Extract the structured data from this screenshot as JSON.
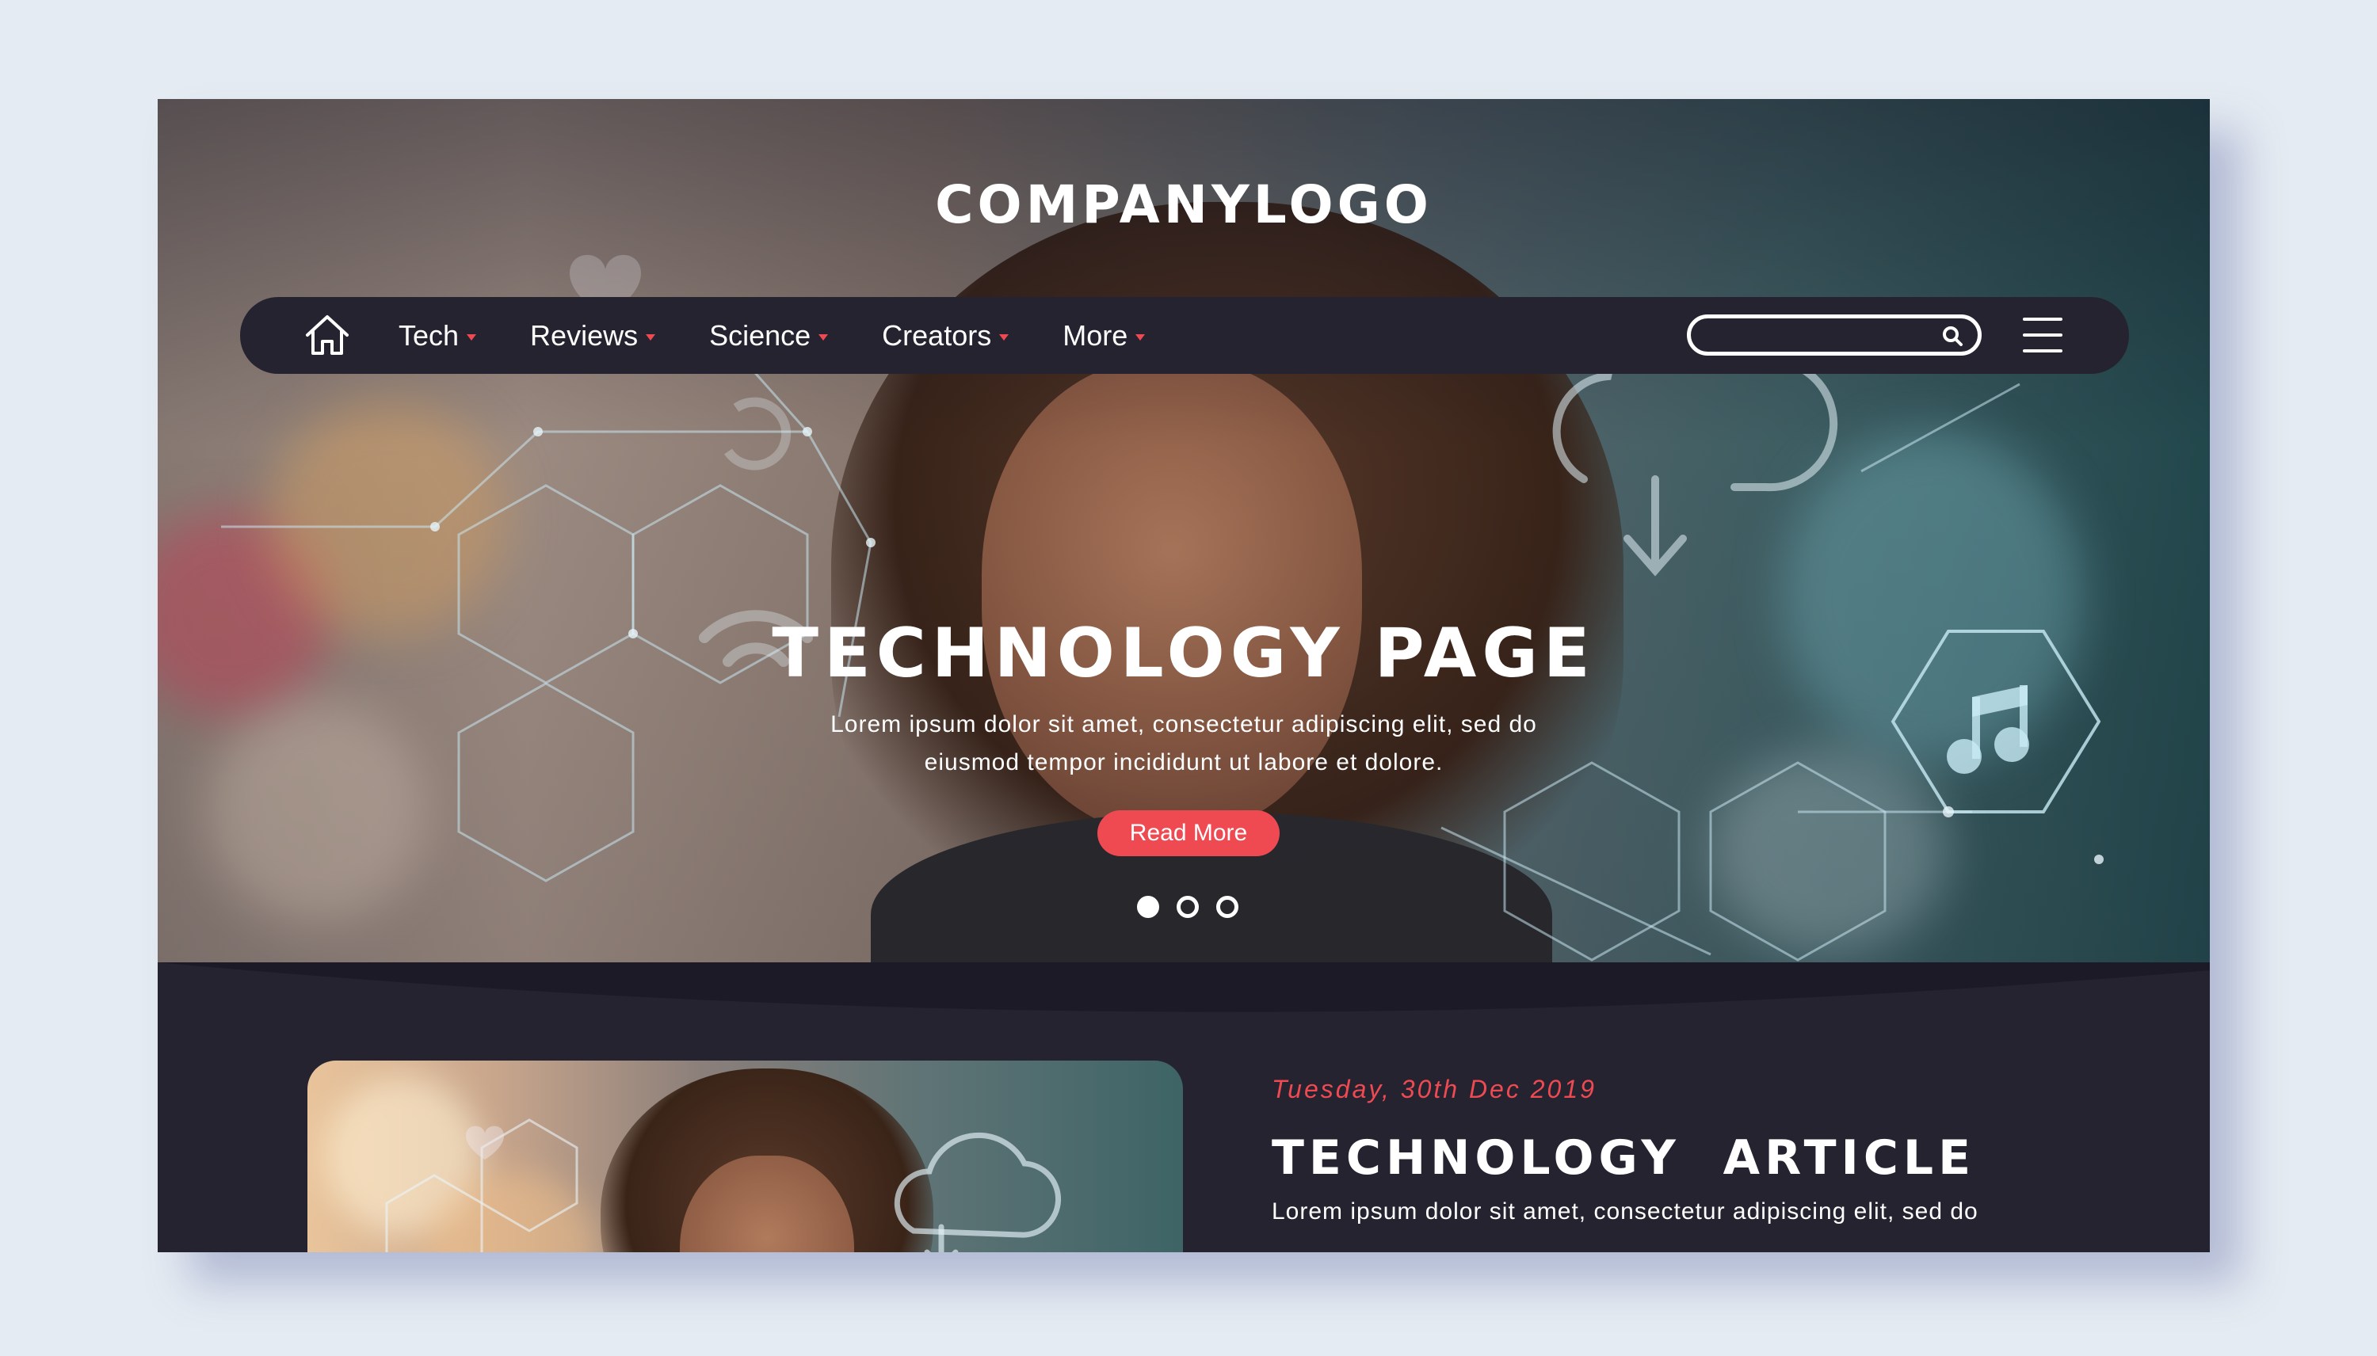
{
  "header": {
    "logo": "COMPANYLOGO"
  },
  "nav": {
    "home_icon": "home-icon",
    "items": [
      {
        "label": "Tech"
      },
      {
        "label": "Reviews"
      },
      {
        "label": "Science"
      },
      {
        "label": "Creators"
      },
      {
        "label": "More"
      }
    ],
    "search": {
      "value": "",
      "placeholder": "",
      "icon": "search-icon"
    },
    "menu_icon": "hamburger-icon"
  },
  "hero": {
    "title": "TECHNOLOGY PAGE",
    "description": "Lorem ipsum dolor sit amet, consectetur adipiscing elit, sed do eiusmod tempor incididunt ut labore et dolore.",
    "cta_label": "Read More",
    "slides": {
      "total": 3,
      "active": 1
    }
  },
  "article": {
    "date": "Tuesday, 30th Dec 2019",
    "title": "TECHNOLOGY  ARTICLE",
    "description": "Lorem ipsum dolor sit amet, consectetur adipiscing elit, sed do"
  },
  "colors": {
    "accent": "#ef4a52",
    "dark": "#262331",
    "page_bg": "#e5ebf2"
  }
}
